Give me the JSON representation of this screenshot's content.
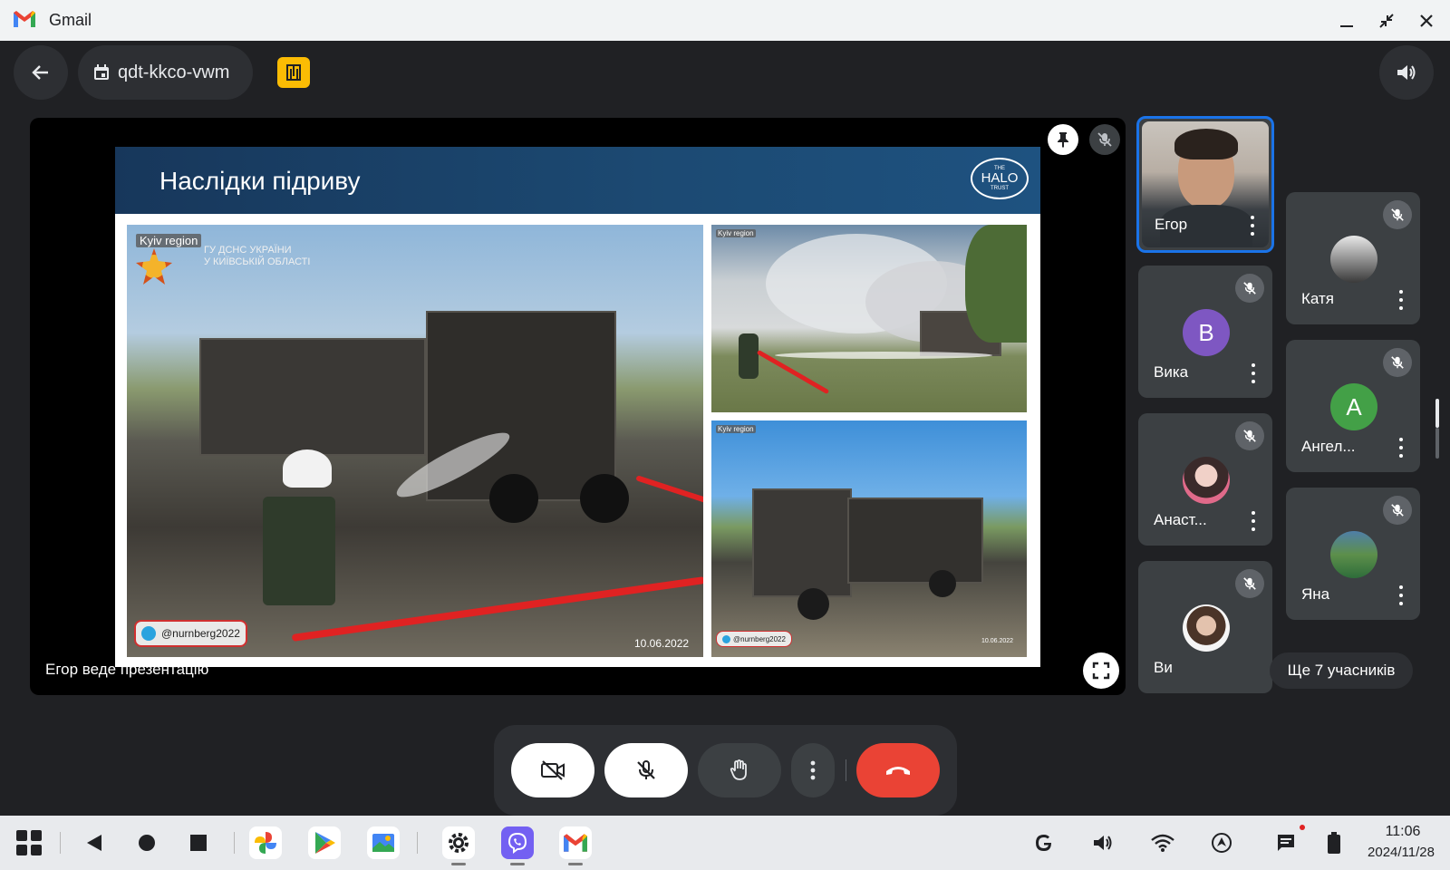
{
  "window": {
    "app_title": "Gmail"
  },
  "top_bar": {
    "meeting_code": "qdt-kkco-vwm"
  },
  "presentation": {
    "slide_title": "Наслідки підриву",
    "logo_text_small": "THE",
    "logo_text_main": "HALO",
    "logo_text_sub": "TRUST",
    "photo_main": {
      "region_tag": "Kyiv region",
      "dsns_line1": "ГУ ДСНС УКРАЇНИ",
      "dsns_line2": "У КИЇВСЬКІЙ ОБЛАСТІ",
      "telegram_handle": "@nurnberg2022",
      "date": "10.06.2022"
    },
    "photo_top_right": {
      "region_tag": "Kyiv region"
    },
    "photo_bottom_right": {
      "region_tag": "Kyiv region",
      "telegram_handle": "@nurnberg2022",
      "date": "10.06.2022"
    },
    "presenter_caption": "Егор веде презентацію"
  },
  "participants": [
    {
      "name": "Егор",
      "active": true,
      "muted": false
    },
    {
      "name": "Вика",
      "avatar_letter": "В",
      "avatar_color": "#7e57c2",
      "muted": true
    },
    {
      "name": "Анаст...",
      "muted": true
    },
    {
      "name": "Ви",
      "muted": true
    },
    {
      "name": "Катя",
      "muted": true
    },
    {
      "name": "Ангел...",
      "avatar_letter": "А",
      "avatar_color": "#43a047",
      "muted": true
    },
    {
      "name": "Яна",
      "muted": true
    }
  ],
  "more_participants": "Ще 7 учасників",
  "taskbar": {
    "time": "11:06",
    "date": "2024/11/28"
  },
  "colors": {
    "accent": "#1a73e8",
    "end_call": "#ea4335",
    "presenting": "#fbbc04"
  }
}
